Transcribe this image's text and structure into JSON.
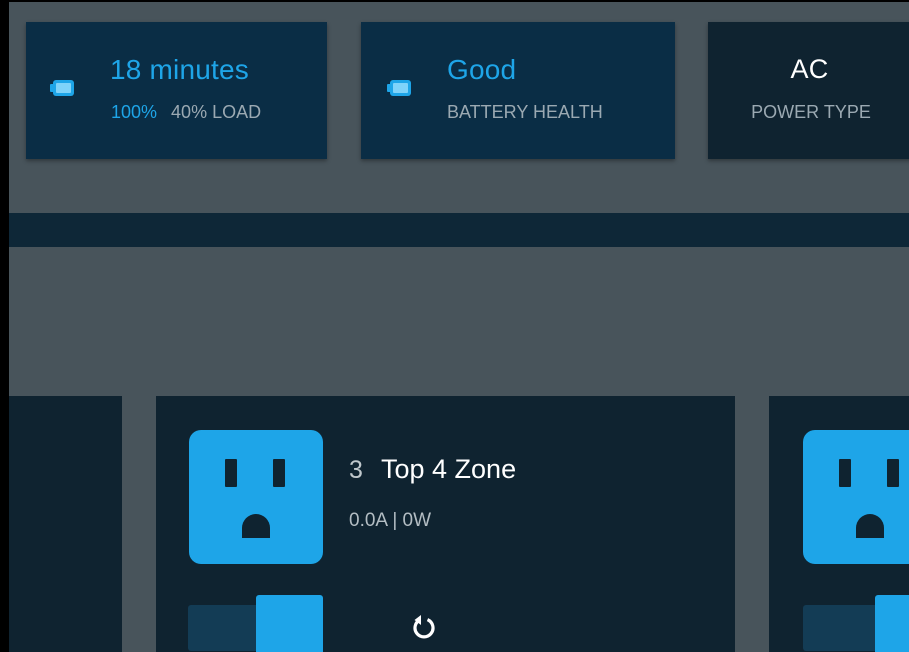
{
  "status_cards": {
    "runtime": {
      "value": "18 minutes",
      "charge": "100%",
      "load": "40% LOAD",
      "icon": "battery-icon"
    },
    "health": {
      "value": "Good",
      "label": "BATTERY HEALTH",
      "icon": "battery-icon"
    },
    "power": {
      "value": "AC",
      "label": "POWER TYPE"
    }
  },
  "outlets": [
    {
      "number": "3",
      "name": "Top 4 Zone",
      "reading": "0.0A | 0W",
      "state": "on",
      "icon": "outlet-icon",
      "action_icon": "reboot-icon"
    },
    {
      "state": "on",
      "icon": "outlet-icon"
    }
  ],
  "colors": {
    "accent": "#1ea5e8",
    "card": "#0f2330",
    "card_highlight": "#0a2d45",
    "background": "#48545b"
  }
}
